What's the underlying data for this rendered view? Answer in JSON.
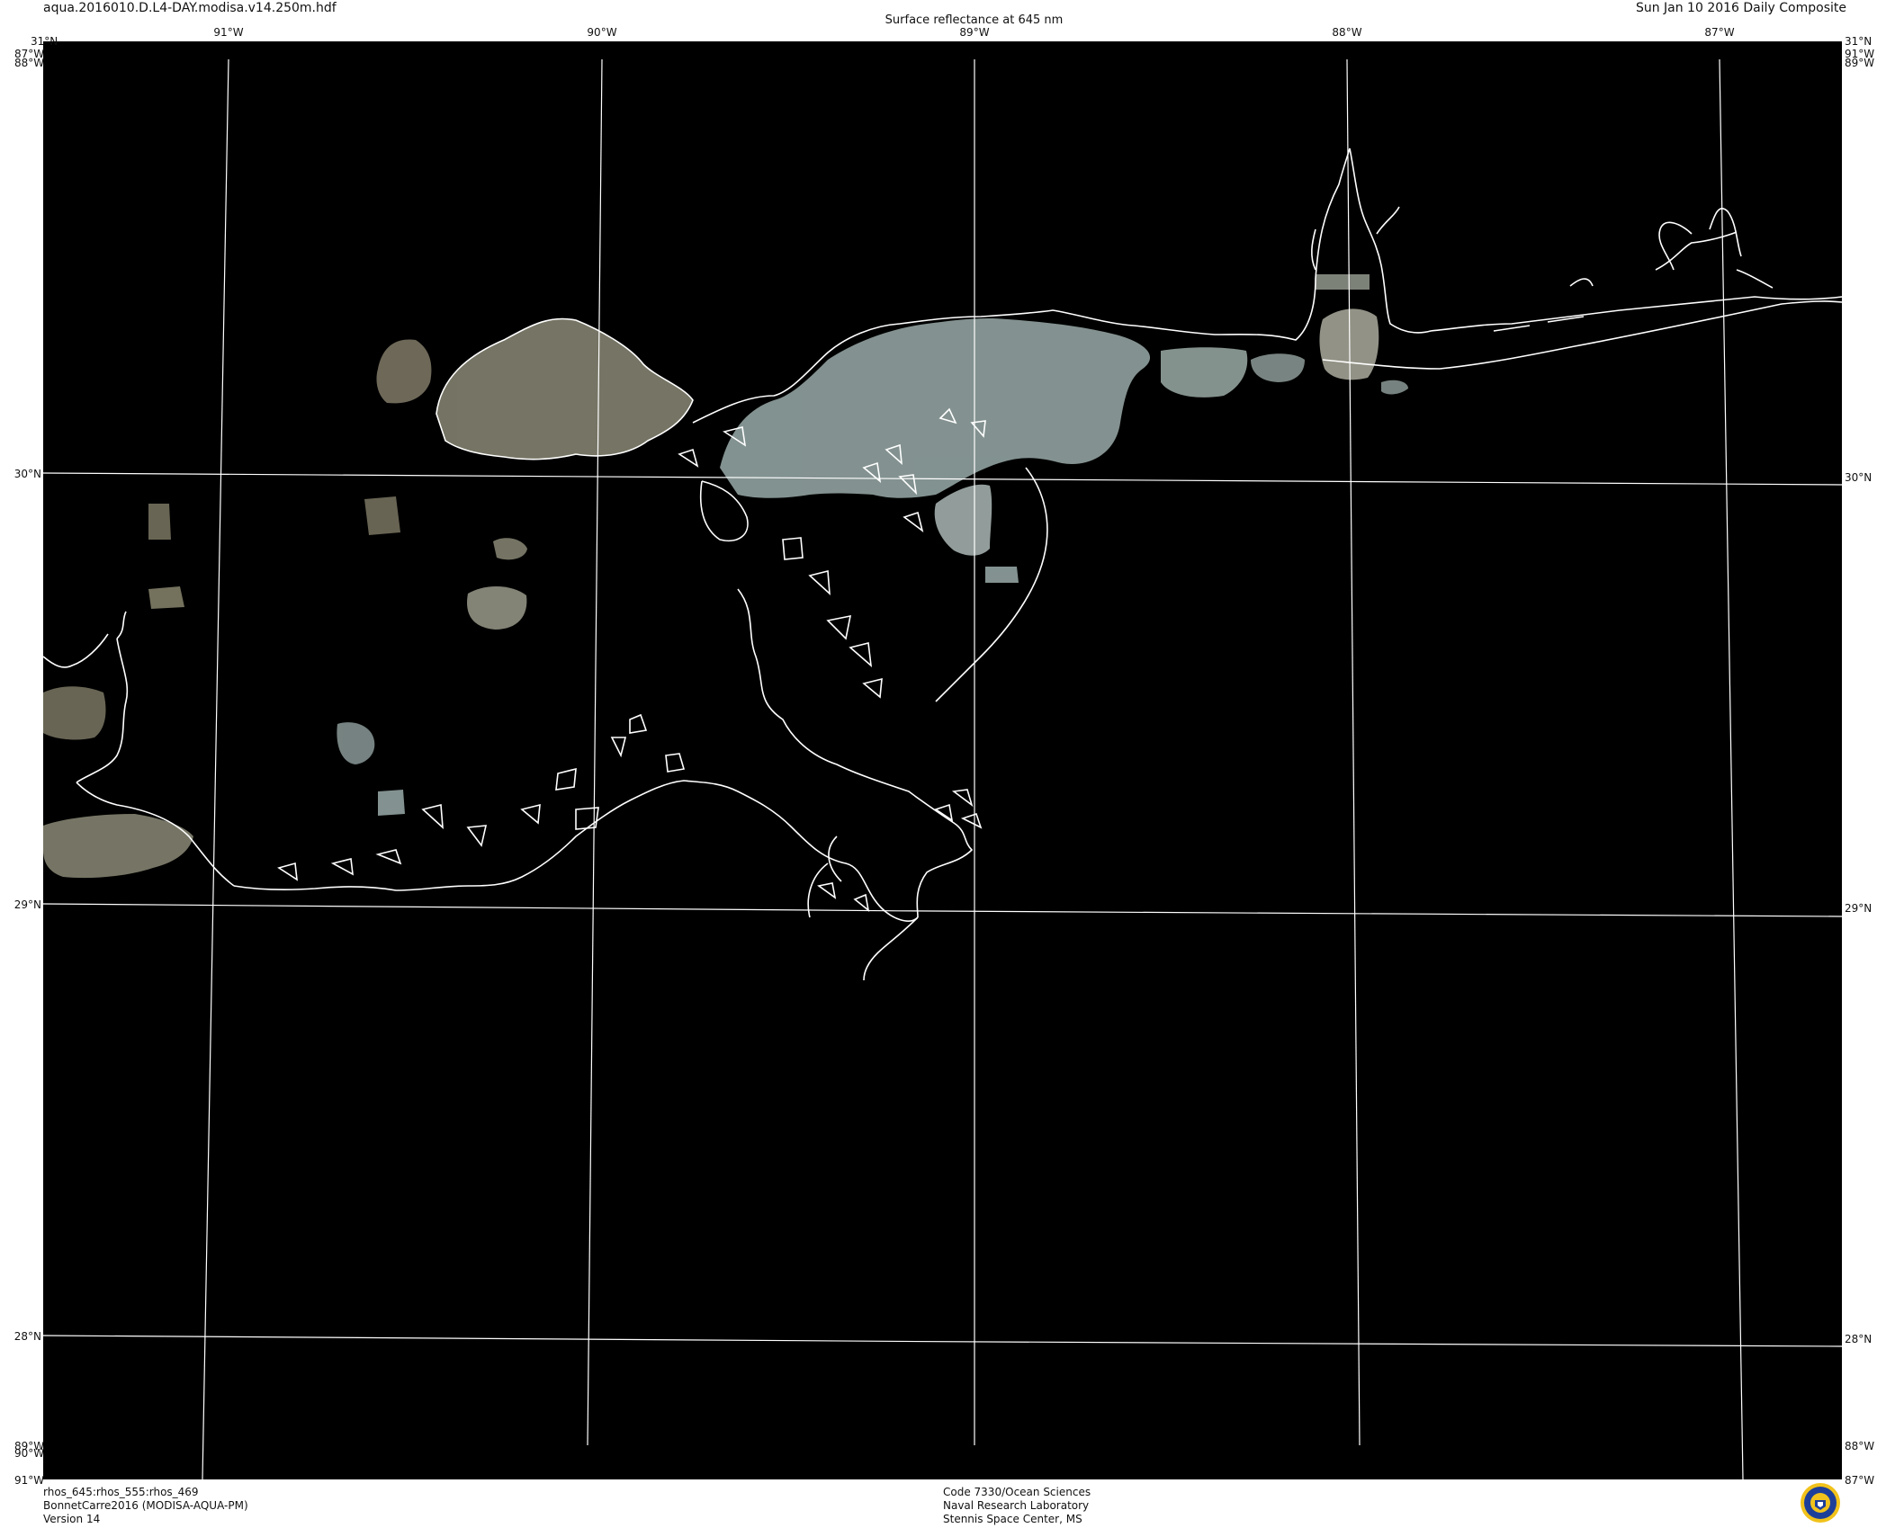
{
  "header": {
    "filename": "aqua.2016010.D.L4-DAY.modisa.v14.250m.hdf",
    "title": "Surface reflectance at 645 nm",
    "date": "Sun Jan 10 2016 Daily Composite"
  },
  "map": {
    "background_color": "#000000",
    "grid_color": "#ffffff",
    "coastline_color": "#ffffff",
    "imagery_colors": [
      "#7c7b6a",
      "#8a9a98",
      "#6e6a58",
      "#9aa6a4"
    ],
    "lon_labels_top": [
      "91°W",
      "90°W",
      "89°W",
      "88°W",
      "87°W"
    ],
    "lat_labels": [
      "30°N",
      "29°N",
      "28°N"
    ],
    "corner_labels": {
      "top_left_lat": "31°N",
      "top_left_lon_a": "87°W",
      "top_left_lon_b": "88°W",
      "top_right_lat": "31°N",
      "top_right_lon_a": "91°W",
      "top_right_lon_b": "89°W",
      "bottom_left_lon_a": "89°W",
      "bottom_left_lon_b": "90°W",
      "bottom_left_lon_c": "91°W",
      "bottom_right_lon_a": "88°W",
      "bottom_right_lon_b": "87°W"
    }
  },
  "footer": {
    "left": [
      "rhos_645:rhos_555:rhos_469",
      "BonnetCarre2016 (MODISA-AQUA-PM)",
      "Version 14"
    ],
    "center": [
      "Code 7330/Ocean Sciences",
      "Naval Research Laboratory",
      "Stennis Space Center, MS"
    ]
  },
  "logo": {
    "icon": "nrl-seal-icon"
  }
}
